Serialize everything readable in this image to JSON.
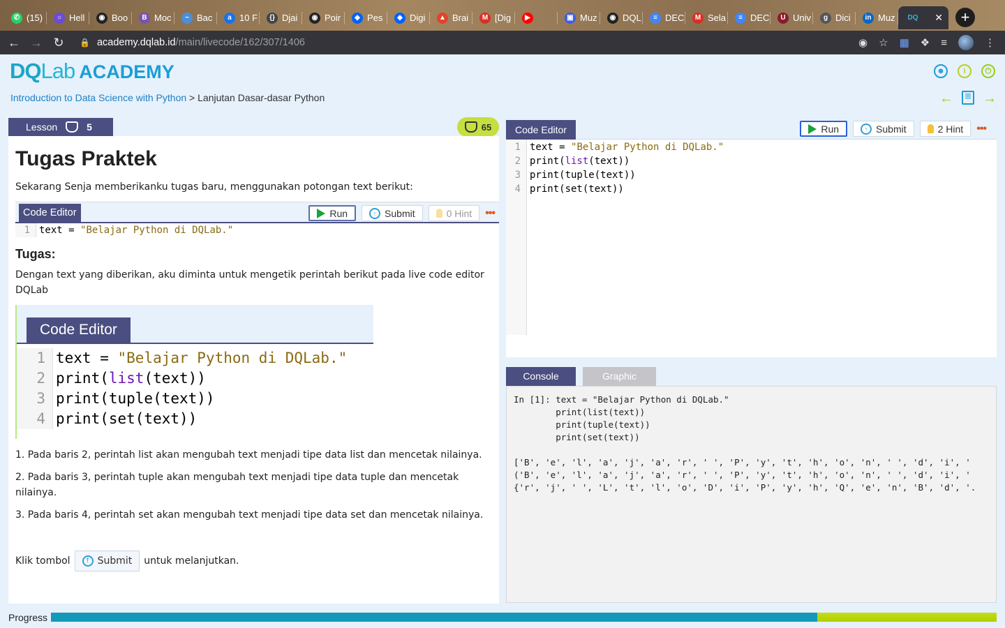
{
  "browser": {
    "tabs": [
      {
        "label": "(15)",
        "icon": "whatsapp-icon",
        "color": "#25d366"
      },
      {
        "label": "Hell",
        "icon": "circle-icon",
        "color": "#6b4bd8"
      },
      {
        "label": "Boo",
        "icon": "globe-icon",
        "color": "#222222"
      },
      {
        "label": "Moc",
        "icon": "bootstrap-icon",
        "color": "#7952b3"
      },
      {
        "label": "Bac",
        "icon": "wave-icon",
        "color": "#4a8fd8"
      },
      {
        "label": "10 F",
        "icon": "at-icon",
        "color": "#1a73e8"
      },
      {
        "label": "Djai",
        "icon": "bracket-icon",
        "color": "#444444"
      },
      {
        "label": "Poir",
        "icon": "globe-icon",
        "color": "#222222"
      },
      {
        "label": "Pes",
        "icon": "dropbox-icon",
        "color": "#0061ff"
      },
      {
        "label": "Digi",
        "icon": "dropbox-icon",
        "color": "#0061ff"
      },
      {
        "label": "Brai",
        "icon": "gitlab-icon",
        "color": "#e24329"
      },
      {
        "label": "[Dig",
        "icon": "gmail-icon",
        "color": "#d93025"
      },
      {
        "label": "",
        "icon": "youtube-icon",
        "color": "#ff0000"
      },
      {
        "label": "Muz",
        "icon": "shield-icon",
        "color": "#3b5de7"
      },
      {
        "label": "DQL",
        "icon": "globe-icon",
        "color": "#222222"
      },
      {
        "label": "DEC",
        "icon": "docs-icon",
        "color": "#4285f4"
      },
      {
        "label": "Sela",
        "icon": "gmail-icon",
        "color": "#d93025"
      },
      {
        "label": "DEC",
        "icon": "docs-icon",
        "color": "#4285f4"
      },
      {
        "label": "Univ",
        "icon": "univ-icon",
        "color": "#8b1a2b"
      },
      {
        "label": "Dici",
        "icon": "g-icon",
        "color": "#555555"
      },
      {
        "label": "Muz",
        "icon": "linkedin-icon",
        "color": "#0a66c2"
      }
    ],
    "active_tab": {
      "label": "DQ",
      "icon": "dqlab-icon"
    },
    "url_host": "academy.dqlab.id",
    "url_path": "/main/livecode/162/307/1406"
  },
  "site": {
    "logo_dq": "DQ",
    "logo_lab": "Lab",
    "logo_academy": "ACADEMY",
    "breadcrumb_course": "Introduction to Data Science with Python",
    "breadcrumb_sep": " > ",
    "breadcrumb_chapter": "Lanjutan Dasar-dasar Python"
  },
  "lesson": {
    "tab_label": "Lesson",
    "count": "5",
    "score": "65",
    "title": "Tugas Praktek",
    "intro": "Sekarang Senja memberikanku tugas baru, menggunakan potongan text berikut:",
    "mini_editor": {
      "tab": "Code Editor",
      "run": "Run",
      "submit": "Submit",
      "hint": "0 Hint",
      "lines": [
        "text = \"Belajar Python di DQLab.\""
      ]
    },
    "tugas_heading": "Tugas:",
    "tugas_text": "Dengan text yang diberikan, aku diminta untuk mengetik perintah berikut pada live code editor DQLab",
    "image_editor": {
      "tab": "Code Editor"
    },
    "steps": [
      "1. Pada baris 2, perintah list akan mengubah text menjadi tipe data list dan mencetak nilainya.",
      "2. Pada baris 3, perintah tuple akan mengubah text menjadi tipe data tuple dan mencetak nilainya.",
      "3. Pada baris 4, perintah set akan mengubah text menjadi tipe data set dan mencetak nilainya."
    ],
    "klik_before": "Klik tombol",
    "klik_button": "Submit",
    "klik_after": "untuk melanjutkan."
  },
  "editor": {
    "tab": "Code Editor",
    "run": "Run",
    "submit": "Submit",
    "hint": "2 Hint",
    "line_numbers": [
      "1",
      "2",
      "3",
      "4"
    ]
  },
  "console": {
    "tab_console": "Console",
    "tab_graphic": "Graphic",
    "output": "In [1]: text = \"Belajar Python di DQLab.\"\n        print(list(text))\n        print(tuple(text))\n        print(set(text))\n\n['B', 'e', 'l', 'a', 'j', 'a', 'r', ' ', 'P', 'y', 't', 'h', 'o', 'n', ' ', 'd', 'i', '\n('B', 'e', 'l', 'a', 'j', 'a', 'r', ' ', 'P', 'y', 't', 'h', 'o', 'n', ' ', 'd', 'i', '\n{'r', 'j', ' ', 'L', 't', 'l', 'o', 'D', 'i', 'P', 'y', 'h', 'Q', 'e', 'n', 'B', 'd', '."
  },
  "progress": {
    "label": "Progress",
    "value_fraction": 0.81
  }
}
